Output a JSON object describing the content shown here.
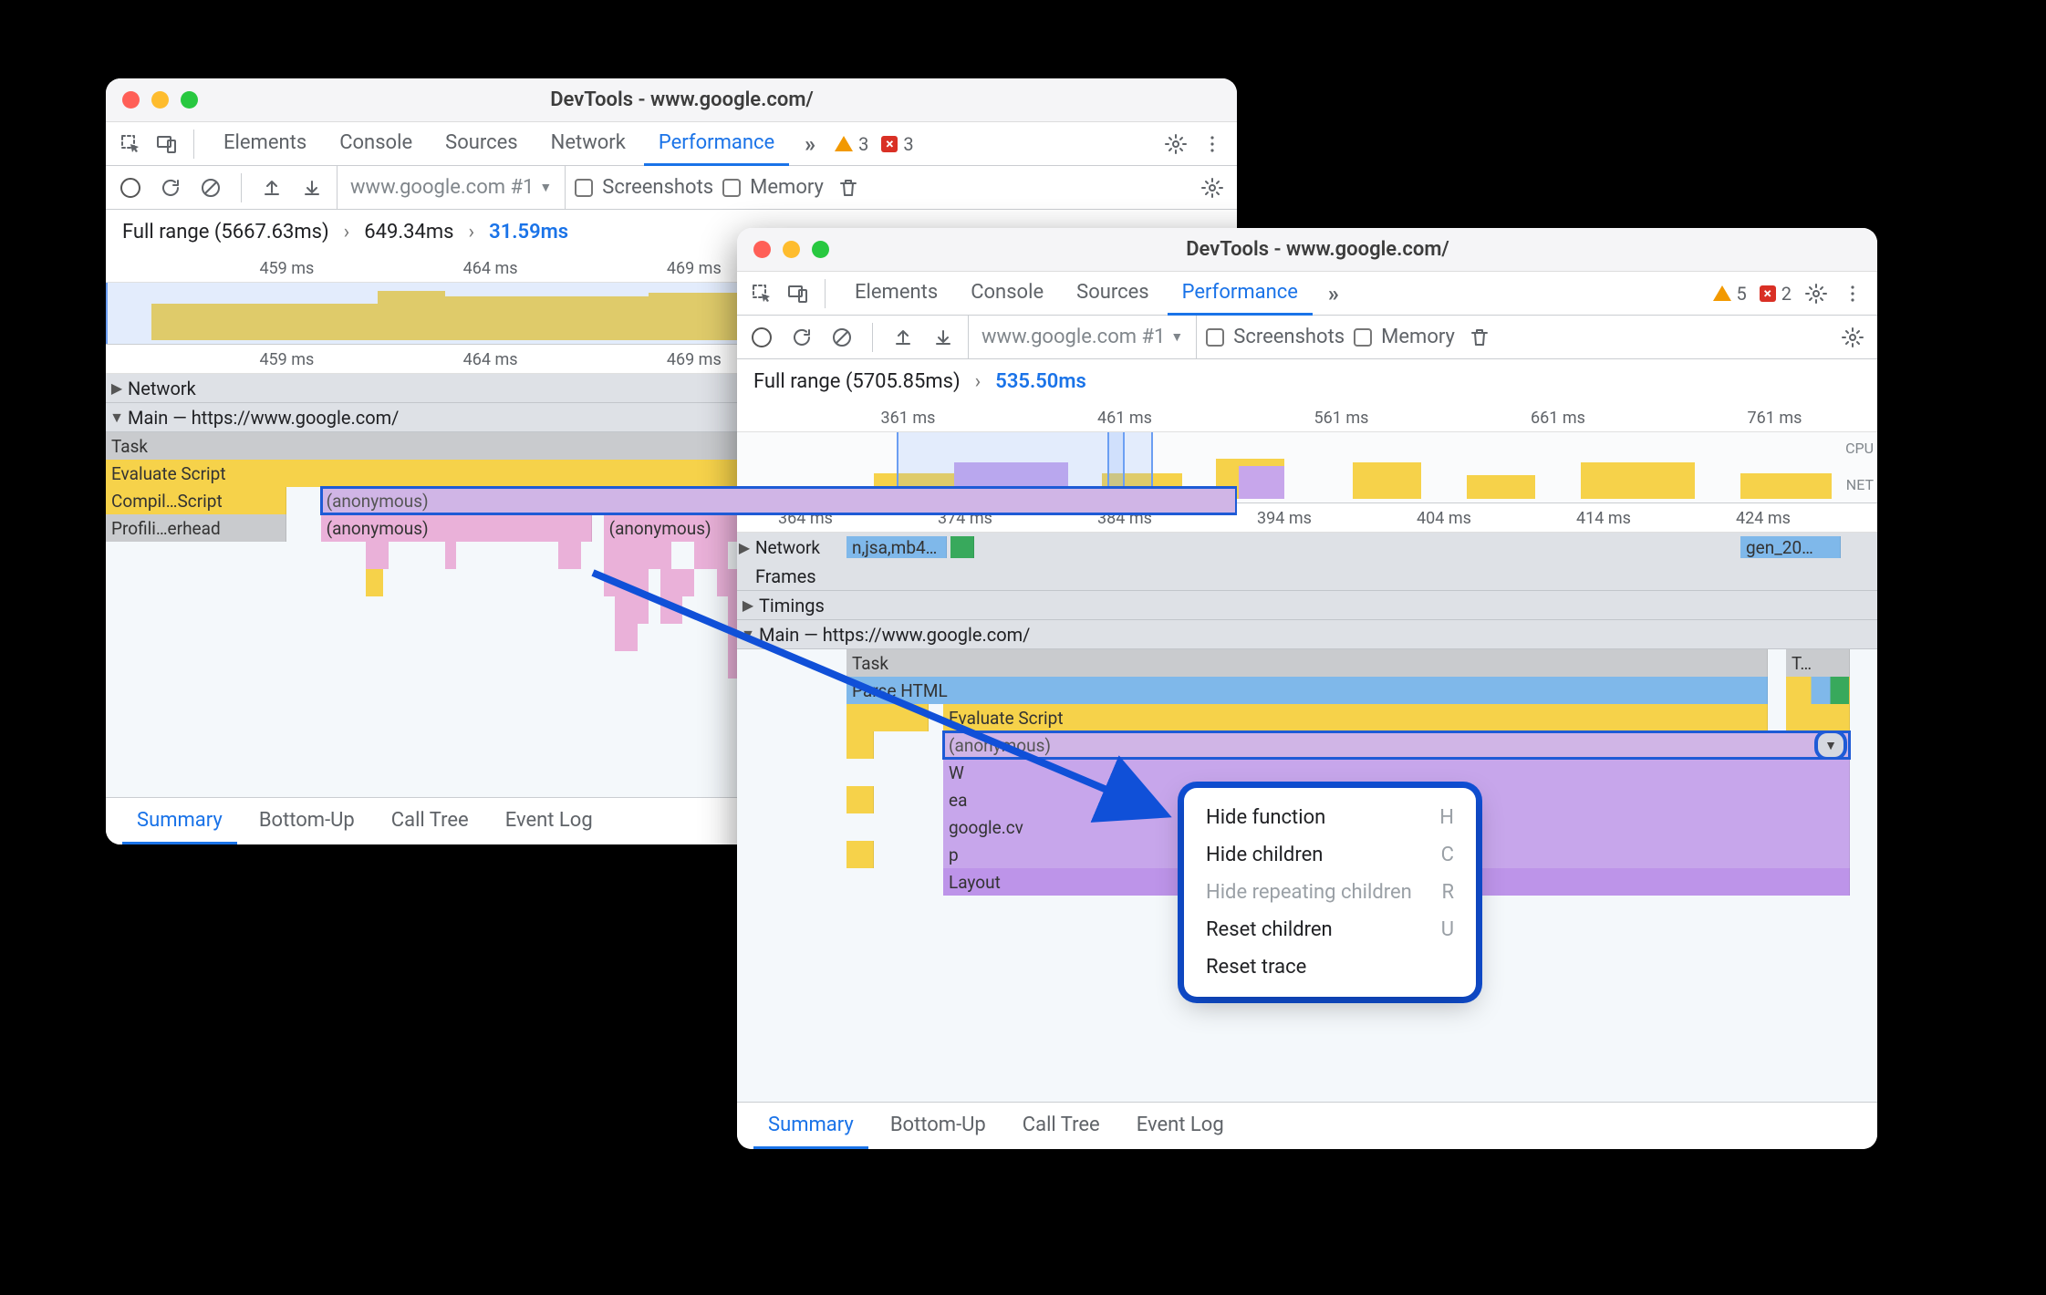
{
  "windowA": {
    "title": "DevTools - www.google.com/",
    "tabs": [
      "Elements",
      "Console",
      "Sources",
      "Network",
      "Performance"
    ],
    "tabs_active_index": 4,
    "more_glyph": "»",
    "warn_count": "3",
    "err_count": "3",
    "toolbar": {
      "recording_select": "www.google.com #1",
      "chk_screenshots": "Screenshots",
      "chk_memory": "Memory"
    },
    "crumbs": {
      "full_range": "Full range (5667.63ms)",
      "mid": "649.34ms",
      "leaf": "31.59ms"
    },
    "overview_ticks": [
      "459 ms",
      "464 ms",
      "469 ms"
    ],
    "ruler_ticks": [
      "459 ms",
      "464 ms",
      "469 ms"
    ],
    "tracks": {
      "network": "Network",
      "main": "Main — https://www.google.com/"
    },
    "flame": {
      "task": "Task",
      "evaluate_script": "Evaluate Script",
      "compile_script": "Compil…Script",
      "anonymous": "(anonymous)",
      "profiler_overhead": "Profili…erhead"
    },
    "bottom_tabs": [
      "Summary",
      "Bottom-Up",
      "Call Tree",
      "Event Log"
    ],
    "bottom_active_index": 0
  },
  "windowB": {
    "title": "DevTools - www.google.com/",
    "tabs": [
      "Elements",
      "Console",
      "Sources",
      "Performance"
    ],
    "tabs_active_index": 3,
    "more_glyph": "»",
    "warn_count": "5",
    "err_count": "2",
    "toolbar": {
      "recording_select": "www.google.com #1",
      "chk_screenshots": "Screenshots",
      "chk_memory": "Memory"
    },
    "crumbs": {
      "full_range": "Full range (5705.85ms)",
      "leaf": "535.50ms"
    },
    "overview_ticks": [
      "361 ms",
      "461 ms",
      "561 ms",
      "661 ms",
      "761 ms"
    ],
    "overview_side_labels": [
      "CPU",
      "NET"
    ],
    "ruler_ticks": [
      "364 ms",
      "374 ms",
      "384 ms",
      "394 ms",
      "404 ms",
      "414 ms",
      "424 ms"
    ],
    "tracks": {
      "network": "Network",
      "network_item1": "n,jsa,mb4…",
      "network_item2": "gen_20…",
      "frames": "Frames",
      "timings": "Timings",
      "main": "Main — https://www.google.com/"
    },
    "flame": {
      "task": "Task",
      "task_short": "T…",
      "parse_html": "Parse HTML",
      "evaluate_script": "Evaluate Script",
      "anonymous": "(anonymous)",
      "w": "W",
      "ea": "ea",
      "google_cv": "google.cv",
      "p": "p",
      "layout": "Layout"
    },
    "bottom_tabs": [
      "Summary",
      "Bottom-Up",
      "Call Tree",
      "Event Log"
    ],
    "bottom_active_index": 0
  },
  "context_menu": {
    "items": [
      {
        "label": "Hide function",
        "key": "H",
        "disabled": false
      },
      {
        "label": "Hide children",
        "key": "C",
        "disabled": false
      },
      {
        "label": "Hide repeating children",
        "key": "R",
        "disabled": true
      },
      {
        "label": "Reset children",
        "key": "U",
        "disabled": false
      },
      {
        "label": "Reset trace",
        "key": "",
        "disabled": false
      }
    ]
  },
  "icons": {
    "inspect": "inspect-icon",
    "device": "device-toggle-icon",
    "gear": "gear-icon",
    "kebab": "kebab-icon",
    "reload": "reload-icon",
    "clear": "clear-icon",
    "upload": "upload-icon",
    "download": "download-icon",
    "trash": "trash-icon"
  }
}
